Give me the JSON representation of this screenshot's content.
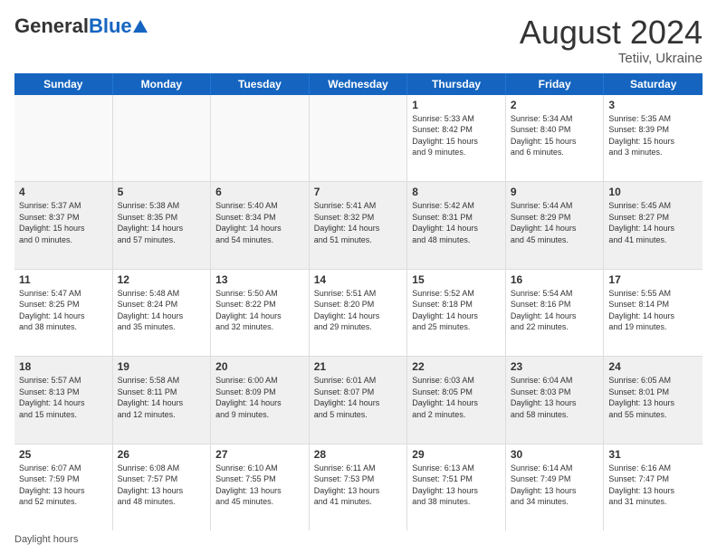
{
  "logo": {
    "general": "General",
    "blue": "Blue"
  },
  "title": {
    "month_year": "August 2024",
    "location": "Tetiiv, Ukraine"
  },
  "headers": [
    "Sunday",
    "Monday",
    "Tuesday",
    "Wednesday",
    "Thursday",
    "Friday",
    "Saturday"
  ],
  "footer": "Daylight hours",
  "weeks": [
    [
      {
        "day": "",
        "info": ""
      },
      {
        "day": "",
        "info": ""
      },
      {
        "day": "",
        "info": ""
      },
      {
        "day": "",
        "info": ""
      },
      {
        "day": "1",
        "info": "Sunrise: 5:33 AM\nSunset: 8:42 PM\nDaylight: 15 hours\nand 9 minutes."
      },
      {
        "day": "2",
        "info": "Sunrise: 5:34 AM\nSunset: 8:40 PM\nDaylight: 15 hours\nand 6 minutes."
      },
      {
        "day": "3",
        "info": "Sunrise: 5:35 AM\nSunset: 8:39 PM\nDaylight: 15 hours\nand 3 minutes."
      }
    ],
    [
      {
        "day": "4",
        "info": "Sunrise: 5:37 AM\nSunset: 8:37 PM\nDaylight: 15 hours\nand 0 minutes."
      },
      {
        "day": "5",
        "info": "Sunrise: 5:38 AM\nSunset: 8:35 PM\nDaylight: 14 hours\nand 57 minutes."
      },
      {
        "day": "6",
        "info": "Sunrise: 5:40 AM\nSunset: 8:34 PM\nDaylight: 14 hours\nand 54 minutes."
      },
      {
        "day": "7",
        "info": "Sunrise: 5:41 AM\nSunset: 8:32 PM\nDaylight: 14 hours\nand 51 minutes."
      },
      {
        "day": "8",
        "info": "Sunrise: 5:42 AM\nSunset: 8:31 PM\nDaylight: 14 hours\nand 48 minutes."
      },
      {
        "day": "9",
        "info": "Sunrise: 5:44 AM\nSunset: 8:29 PM\nDaylight: 14 hours\nand 45 minutes."
      },
      {
        "day": "10",
        "info": "Sunrise: 5:45 AM\nSunset: 8:27 PM\nDaylight: 14 hours\nand 41 minutes."
      }
    ],
    [
      {
        "day": "11",
        "info": "Sunrise: 5:47 AM\nSunset: 8:25 PM\nDaylight: 14 hours\nand 38 minutes."
      },
      {
        "day": "12",
        "info": "Sunrise: 5:48 AM\nSunset: 8:24 PM\nDaylight: 14 hours\nand 35 minutes."
      },
      {
        "day": "13",
        "info": "Sunrise: 5:50 AM\nSunset: 8:22 PM\nDaylight: 14 hours\nand 32 minutes."
      },
      {
        "day": "14",
        "info": "Sunrise: 5:51 AM\nSunset: 8:20 PM\nDaylight: 14 hours\nand 29 minutes."
      },
      {
        "day": "15",
        "info": "Sunrise: 5:52 AM\nSunset: 8:18 PM\nDaylight: 14 hours\nand 25 minutes."
      },
      {
        "day": "16",
        "info": "Sunrise: 5:54 AM\nSunset: 8:16 PM\nDaylight: 14 hours\nand 22 minutes."
      },
      {
        "day": "17",
        "info": "Sunrise: 5:55 AM\nSunset: 8:14 PM\nDaylight: 14 hours\nand 19 minutes."
      }
    ],
    [
      {
        "day": "18",
        "info": "Sunrise: 5:57 AM\nSunset: 8:13 PM\nDaylight: 14 hours\nand 15 minutes."
      },
      {
        "day": "19",
        "info": "Sunrise: 5:58 AM\nSunset: 8:11 PM\nDaylight: 14 hours\nand 12 minutes."
      },
      {
        "day": "20",
        "info": "Sunrise: 6:00 AM\nSunset: 8:09 PM\nDaylight: 14 hours\nand 9 minutes."
      },
      {
        "day": "21",
        "info": "Sunrise: 6:01 AM\nSunset: 8:07 PM\nDaylight: 14 hours\nand 5 minutes."
      },
      {
        "day": "22",
        "info": "Sunrise: 6:03 AM\nSunset: 8:05 PM\nDaylight: 14 hours\nand 2 minutes."
      },
      {
        "day": "23",
        "info": "Sunrise: 6:04 AM\nSunset: 8:03 PM\nDaylight: 13 hours\nand 58 minutes."
      },
      {
        "day": "24",
        "info": "Sunrise: 6:05 AM\nSunset: 8:01 PM\nDaylight: 13 hours\nand 55 minutes."
      }
    ],
    [
      {
        "day": "25",
        "info": "Sunrise: 6:07 AM\nSunset: 7:59 PM\nDaylight: 13 hours\nand 52 minutes."
      },
      {
        "day": "26",
        "info": "Sunrise: 6:08 AM\nSunset: 7:57 PM\nDaylight: 13 hours\nand 48 minutes."
      },
      {
        "day": "27",
        "info": "Sunrise: 6:10 AM\nSunset: 7:55 PM\nDaylight: 13 hours\nand 45 minutes."
      },
      {
        "day": "28",
        "info": "Sunrise: 6:11 AM\nSunset: 7:53 PM\nDaylight: 13 hours\nand 41 minutes."
      },
      {
        "day": "29",
        "info": "Sunrise: 6:13 AM\nSunset: 7:51 PM\nDaylight: 13 hours\nand 38 minutes."
      },
      {
        "day": "30",
        "info": "Sunrise: 6:14 AM\nSunset: 7:49 PM\nDaylight: 13 hours\nand 34 minutes."
      },
      {
        "day": "31",
        "info": "Sunrise: 6:16 AM\nSunset: 7:47 PM\nDaylight: 13 hours\nand 31 minutes."
      }
    ]
  ]
}
